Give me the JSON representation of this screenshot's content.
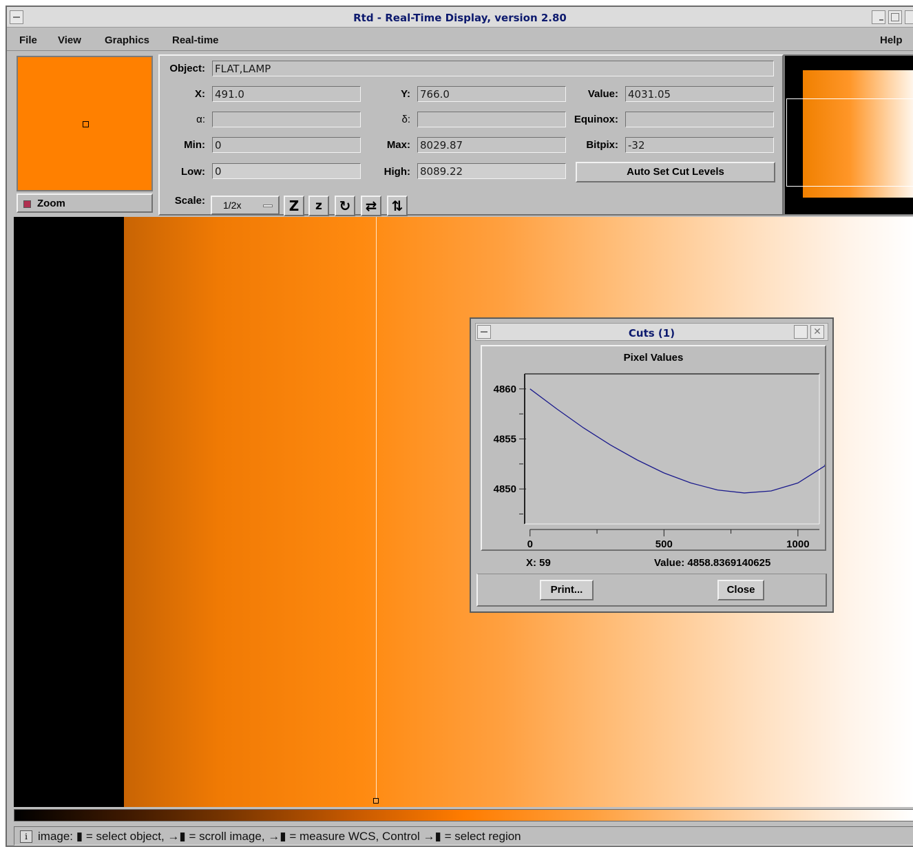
{
  "window": {
    "title": "Rtd - Real-Time Display, version 2.80"
  },
  "menu": {
    "file": "File",
    "view": "View",
    "graphics": "Graphics",
    "realtime": "Real-time",
    "help": "Help"
  },
  "zoom": {
    "label": "Zoom",
    "checked": true
  },
  "info": {
    "object_label": "Object:",
    "object_value": "FLAT,LAMP",
    "x_label": "X:",
    "x_value": "491.0",
    "y_label": "Y:",
    "y_value": "766.0",
    "value_label": "Value:",
    "value_value": "4031.05",
    "alpha_label": "α:",
    "alpha_value": "",
    "delta_label": "δ:",
    "delta_value": "",
    "equinox_label": "Equinox:",
    "equinox_value": "",
    "min_label": "Min:",
    "min_value": "0",
    "max_label": "Max:",
    "max_value": "8029.87",
    "bitpix_label": "Bitpix:",
    "bitpix_value": "-32",
    "low_label": "Low:",
    "low_value": "0",
    "high_label": "High:",
    "high_value": "8089.22",
    "auto_cut_label": "Auto Set Cut Levels",
    "scale_label": "Scale:",
    "scale_value": "1/2x"
  },
  "toolbar_icons": [
    "zoom-in-icon",
    "zoom-out-icon",
    "rotate-icon",
    "flip-x-icon",
    "flip-y-icon"
  ],
  "toolbar_glyphs": [
    "Z",
    "z",
    "↻",
    "⇄",
    "⇅"
  ],
  "status": {
    "text": "image: ▮ = select object, →▮ = scroll image, →▮ = measure WCS, Control →▮ = select region"
  },
  "cuts_dialog": {
    "title": "Cuts (1)",
    "plot_title": "Pixel Values",
    "x_readout": "X: 59",
    "value_readout": "Value: 4858.8369140625",
    "print_label": "Print...",
    "close_label": "Close"
  },
  "chart_data": {
    "type": "line",
    "title": "Pixel Values",
    "xlabel": "",
    "ylabel": "",
    "xlim": [
      -20,
      1080
    ],
    "ylim": [
      4846.5,
      4861.5
    ],
    "x_ticks": [
      0,
      500,
      1000
    ],
    "y_ticks": [
      4850,
      4855,
      4860
    ],
    "series": [
      {
        "color": "#1a1a8c",
        "x": [
          0,
          100,
          200,
          300,
          400,
          500,
          600,
          700,
          800,
          900,
          1000,
          1100,
          1130
        ],
        "y": [
          4860.0,
          4858.0,
          4856.1,
          4854.4,
          4852.9,
          4851.6,
          4850.6,
          4849.9,
          4849.6,
          4849.8,
          4850.6,
          4852.3,
          4855.0
        ]
      }
    ],
    "grid": false
  }
}
